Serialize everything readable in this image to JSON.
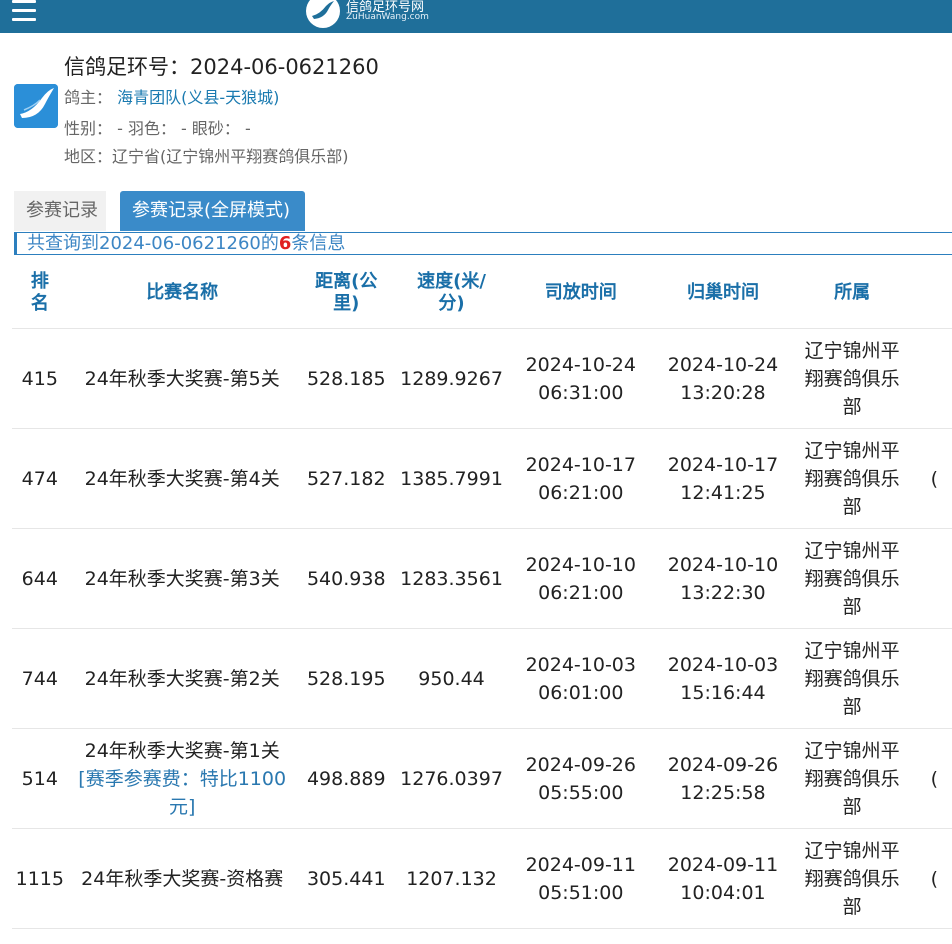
{
  "header": {
    "logo_text": "信鸽足环号网",
    "logo_sub": "ZuHuanWang.com"
  },
  "ring": {
    "title": "信鸽足环号：2024-06-0621260",
    "owner_label": "鸽主：",
    "owner": "海青团队(义县-天狼城)",
    "attrs": "性别：  -  羽色：  -  眼砂：  -",
    "region": "地区：辽宁省(辽宁锦州平翔赛鸽俱乐部)"
  },
  "tabs": [
    {
      "label": "参赛记录"
    },
    {
      "label": "参赛记录(全屏模式)"
    }
  ],
  "notice": {
    "prefix": "共查询到2024-06-0621260的",
    "count": "6",
    "suffix": "条信息"
  },
  "table": {
    "headers": {
      "rank": "排名",
      "race": "比赛名称",
      "distance": "距离(公里)",
      "speed": "速度(米/分)",
      "release": "司放时间",
      "arrival": "归巢时间",
      "club": "所属"
    },
    "rows": [
      {
        "rank": "415",
        "race": "24年秋季大奖赛-第5关",
        "fee": "",
        "distance": "528.185",
        "speed": "1289.9267",
        "release_date": "2024-10-24",
        "release_time": "06:31:00",
        "arrival_date": "2024-10-24",
        "arrival_time": "13:20:28",
        "club": "辽宁锦州平翔赛鸽俱乐部",
        "edge": ""
      },
      {
        "rank": "474",
        "race": "24年秋季大奖赛-第4关",
        "fee": "",
        "distance": "527.182",
        "speed": "1385.7991",
        "release_date": "2024-10-17",
        "release_time": "06:21:00",
        "arrival_date": "2024-10-17",
        "arrival_time": "12:41:25",
        "club": "辽宁锦州平翔赛鸽俱乐部",
        "edge": "("
      },
      {
        "rank": "644",
        "race": "24年秋季大奖赛-第3关",
        "fee": "",
        "distance": "540.938",
        "speed": "1283.3561",
        "release_date": "2024-10-10",
        "release_time": "06:21:00",
        "arrival_date": "2024-10-10",
        "arrival_time": "13:22:30",
        "club": "辽宁锦州平翔赛鸽俱乐部",
        "edge": ""
      },
      {
        "rank": "744",
        "race": "24年秋季大奖赛-第2关",
        "fee": "",
        "distance": "528.195",
        "speed": "950.44",
        "release_date": "2024-10-03",
        "release_time": "06:01:00",
        "arrival_date": "2024-10-03",
        "arrival_time": "15:16:44",
        "club": "辽宁锦州平翔赛鸽俱乐部",
        "edge": ""
      },
      {
        "rank": "514",
        "race": "24年秋季大奖赛-第1关",
        "fee": "[赛季参赛费：特比1100元]",
        "distance": "498.889",
        "speed": "1276.0397",
        "release_date": "2024-09-26",
        "release_time": "05:55:00",
        "arrival_date": "2024-09-26",
        "arrival_time": "12:25:58",
        "club": "辽宁锦州平翔赛鸽俱乐部",
        "edge": "("
      },
      {
        "rank": "1115",
        "race": "24年秋季大奖赛-资格赛",
        "fee": "",
        "distance": "305.441",
        "speed": "1207.132",
        "release_date": "2024-09-11",
        "release_time": "05:51:00",
        "arrival_date": "2024-09-11",
        "arrival_time": "10:04:01",
        "club": "辽宁锦州平翔赛鸽俱乐部",
        "edge": "("
      }
    ]
  },
  "colors": {
    "topbar": "#1f6f9a",
    "accent": "#3a8bc9",
    "link": "#1a7ab0",
    "highlight": "#e02020"
  }
}
